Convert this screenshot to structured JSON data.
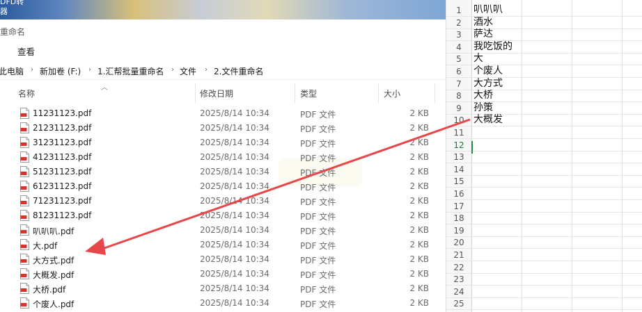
{
  "explorer": {
    "wallpaper_text_line1": "DFD转",
    "wallpaper_text_line2": "器",
    "window_title": "重命名",
    "ribbon": {
      "view_tab": "查看"
    },
    "breadcrumbs": [
      "此电脑",
      "新加卷 (F:)",
      "1.汇帮批量重命名",
      "文件",
      "2.文件重命名"
    ],
    "columns": {
      "name": "名称",
      "date": "修改日期",
      "type": "类型",
      "size": "大小"
    },
    "files": [
      {
        "name": "11231123.pdf",
        "date": "2025/8/14 10:34",
        "type": "PDF 文件",
        "size": "2 KB"
      },
      {
        "name": "21231123.pdf",
        "date": "2025/8/14 10:34",
        "type": "PDF 文件",
        "size": "2 KB"
      },
      {
        "name": "31231123.pdf",
        "date": "2025/8/14 10:34",
        "type": "PDF 文件",
        "size": "2 KB"
      },
      {
        "name": "41231123.pdf",
        "date": "2025/8/14 10:34",
        "type": "PDF 文件",
        "size": "2 KB"
      },
      {
        "name": "51231123.pdf",
        "date": "2025/8/14 10:34",
        "type": "PDF 文件",
        "size": "2 KB"
      },
      {
        "name": "61231123.pdf",
        "date": "2025/8/14 10:34",
        "type": "PDF 文件",
        "size": "2 KB"
      },
      {
        "name": "71231123.pdf",
        "date": "2025/8/14 10:34",
        "type": "PDF 文件",
        "size": "2 KB"
      },
      {
        "name": "81231123.pdf",
        "date": "2025/8/14 10:34",
        "type": "PDF 文件",
        "size": "2 KB"
      },
      {
        "name": "叭叭叭.pdf",
        "date": "2025/8/14 10:34",
        "type": "PDF 文件",
        "size": "2 KB"
      },
      {
        "name": "大.pdf",
        "date": "2025/8/14 10:34",
        "type": "PDF 文件",
        "size": "2 KB"
      },
      {
        "name": "大方式.pdf",
        "date": "2025/8/14 10:34",
        "type": "PDF 文件",
        "size": "2 KB"
      },
      {
        "name": "大概发.pdf",
        "date": "2025/8/14 10:34",
        "type": "PDF 文件",
        "size": "2 KB"
      },
      {
        "name": "大桥.pdf",
        "date": "2025/8/14 10:34",
        "type": "PDF 文件",
        "size": "2 KB"
      },
      {
        "name": "个废人.pdf",
        "date": "2025/8/14 10:34",
        "type": "PDF 文件",
        "size": "2 KB"
      }
    ]
  },
  "sheet": {
    "active_row": "12",
    "rows": [
      {
        "num": "1",
        "value": "叭叭叭"
      },
      {
        "num": "2",
        "value": "酒水"
      },
      {
        "num": "3",
        "value": "萨达"
      },
      {
        "num": "4",
        "value": "我吃饭的"
      },
      {
        "num": "5",
        "value": "大"
      },
      {
        "num": "6",
        "value": "个废人"
      },
      {
        "num": "7",
        "value": "大方式"
      },
      {
        "num": "8",
        "value": "大桥"
      },
      {
        "num": "9",
        "value": "孙策"
      },
      {
        "num": "10",
        "value": "大概发"
      },
      {
        "num": "11",
        "value": ""
      },
      {
        "num": "12",
        "value": ""
      },
      {
        "num": "13",
        "value": ""
      },
      {
        "num": "14",
        "value": ""
      },
      {
        "num": "15",
        "value": ""
      },
      {
        "num": "16",
        "value": ""
      },
      {
        "num": "17",
        "value": ""
      },
      {
        "num": "18",
        "value": ""
      },
      {
        "num": "19",
        "value": ""
      },
      {
        "num": "20",
        "value": ""
      },
      {
        "num": "21",
        "value": ""
      },
      {
        "num": "22",
        "value": ""
      },
      {
        "num": "23",
        "value": ""
      },
      {
        "num": "24",
        "value": ""
      },
      {
        "num": "25",
        "value": ""
      }
    ]
  },
  "colors": {
    "annotation_arrow": "#e8474a",
    "active_cell": "#1f8b46",
    "pdf_icon": "#d9342b"
  }
}
